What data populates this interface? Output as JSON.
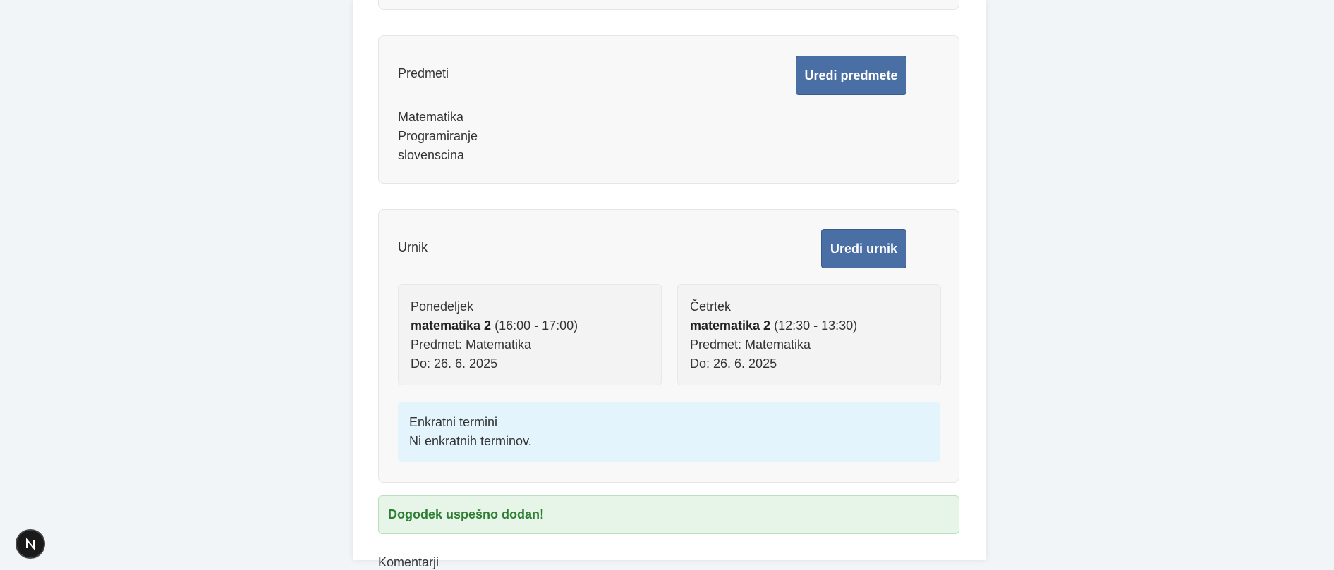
{
  "subjects": {
    "title": "Predmeti",
    "edit_button": "Uredi predmete",
    "items": [
      "Matematika",
      "Programiranje",
      "slovenscina"
    ]
  },
  "schedule": {
    "title": "Urnik",
    "edit_button": "Uredi urnik",
    "slots": [
      {
        "day": "Ponedeljek",
        "name": "matematika 2",
        "time": "(16:00 - 17:00)",
        "subject": "Predmet: Matematika",
        "until": "Do: 26. 6. 2025"
      },
      {
        "day": "Četrtek",
        "name": "matematika 2",
        "time": "(12:30 - 13:30)",
        "subject": "Predmet: Matematika",
        "until": "Do: 26. 6. 2025"
      }
    ],
    "one_time": {
      "title": "Enkratni termini",
      "empty_text": "Ni enkratnih terminov."
    }
  },
  "alert": {
    "success_text": "Dogodek uspešno dodan!"
  },
  "cut_off_label": "Komentarji",
  "colors": {
    "button": "#4a6fa5",
    "success_text": "#2e7d32",
    "success_bg": "#e7f5e8",
    "info_bg": "#e3f4fc"
  },
  "icons": {
    "dev_badge": "nextjs-logo-icon"
  }
}
